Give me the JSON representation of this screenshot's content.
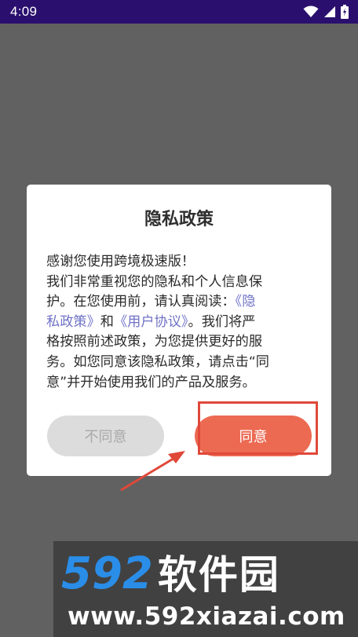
{
  "status_bar": {
    "time": "4:09",
    "icons": [
      "wifi-icon",
      "signal-icon",
      "battery-icon"
    ]
  },
  "dialog": {
    "title": "隐私政策",
    "body_lines": [
      [
        "感谢您使用跨境极速版！"
      ],
      [
        "我们非常重视您的隐私和个人信息保"
      ],
      [
        "护。在您使用前，请认真阅读："
      ],
      [
        "私政策》",
        "和",
        "《用户协议》",
        "。我们将严"
      ],
      [
        "格按照前述政策，为您提供更好的服"
      ],
      [
        "务。如您同意该隐私政策，请点击“同"
      ],
      [
        "意”并开始使用我们的产品及服务。"
      ]
    ],
    "link_open": "《隐",
    "buttons": {
      "decline": "不同意",
      "agree": "同意"
    }
  },
  "watermark": {
    "logo_number": "592",
    "logo_text": "软件园",
    "url": "www.592xiazai.com"
  },
  "colors": {
    "status_bar_bg": "#2a0f6e",
    "overlay_bg": "#616161",
    "agree_button": "#ec6a52",
    "decline_button": "#dcdcdc",
    "link": "#6f72c6",
    "annotation_red": "#e0483a",
    "logo_blue": "#2a8de8"
  }
}
